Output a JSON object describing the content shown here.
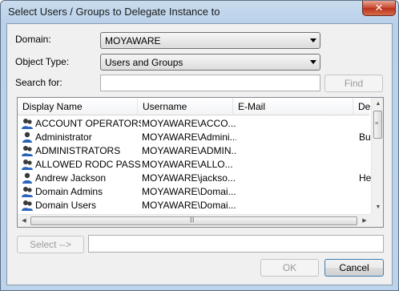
{
  "window": {
    "title": "Select Users / Groups to Delegate Instance to",
    "close_glyph": "✕"
  },
  "form": {
    "domain_label": "Domain:",
    "domain_value": "MOYAWARE",
    "object_type_label": "Object Type:",
    "object_type_value": "Users and Groups",
    "search_label": "Search for:",
    "search_value": "",
    "find_label": "Find"
  },
  "list": {
    "columns": [
      "Display Name",
      "Username",
      "E-Mail",
      "Des"
    ],
    "rows": [
      {
        "icon": "group-icon",
        "name": "ACCOUNT OPERATORS",
        "username": "MOYAWARE\\ACCO...",
        "email": "",
        "desc": ""
      },
      {
        "icon": "user-icon",
        "name": "Administrator",
        "username": "MOYAWARE\\Admini...",
        "email": "",
        "desc": "Bui"
      },
      {
        "icon": "group-icon",
        "name": "ADMINISTRATORS",
        "username": "MOYAWARE\\ADMIN...",
        "email": "",
        "desc": ""
      },
      {
        "icon": "group-icon",
        "name": "ALLOWED RODC PASS...",
        "username": "MOYAWARE\\ALLO...",
        "email": "",
        "desc": ""
      },
      {
        "icon": "user-icon",
        "name": "Andrew Jackson",
        "username": "MOYAWARE\\jackso...",
        "email": "",
        "desc": "Hea"
      },
      {
        "icon": "group-icon",
        "name": "Domain Admins",
        "username": "MOYAWARE\\Domai...",
        "email": "",
        "desc": ""
      },
      {
        "icon": "group-icon",
        "name": "Domain Users",
        "username": "MOYAWARE\\Domai...",
        "email": "",
        "desc": ""
      }
    ],
    "vscroll_position": 0.0,
    "hscroll_position": 0.0
  },
  "selection": {
    "select_label": "Select -->",
    "selected_value": ""
  },
  "footer": {
    "ok_label": "OK",
    "cancel_label": "Cancel"
  }
}
